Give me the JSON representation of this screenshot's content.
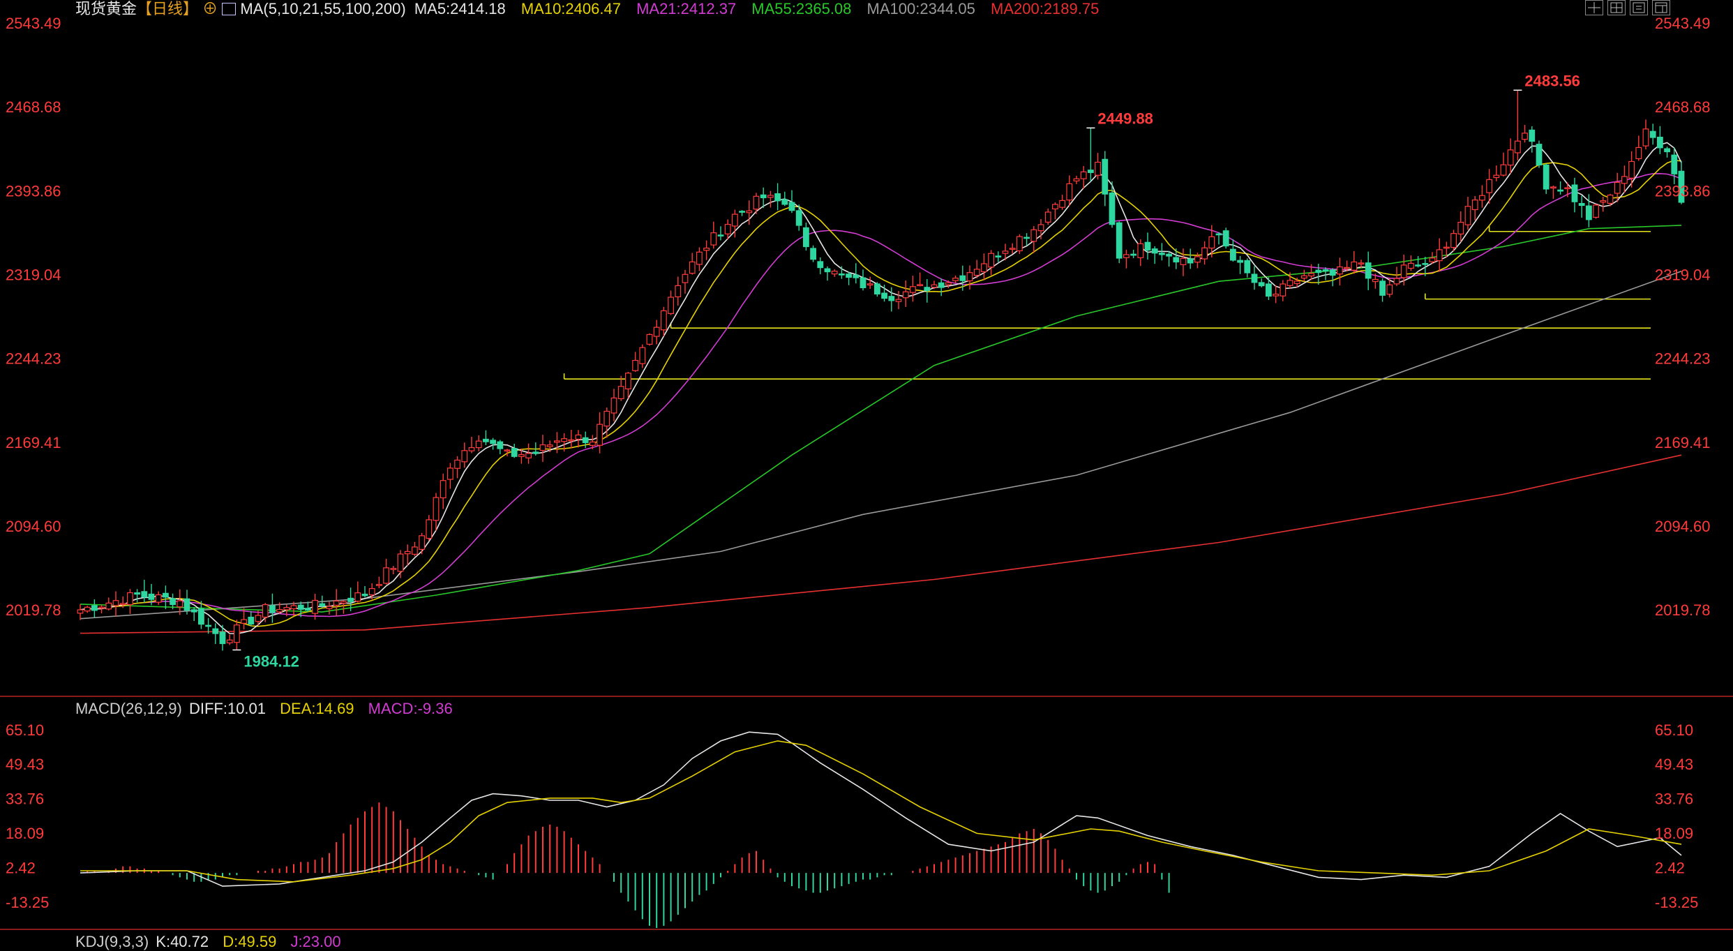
{
  "header": {
    "symbol": "现货黄金",
    "period": "【日线】",
    "ma_params": "MA(5,10,21,55,100,200)",
    "ma_values": [
      {
        "label": "MA5:2414.18",
        "color": "#e6e6e6"
      },
      {
        "label": "MA10:2406.47",
        "color": "#e6d200"
      },
      {
        "label": "MA21:2412.37",
        "color": "#d23cd2"
      },
      {
        "label": "MA55:2365.08",
        "color": "#28c828"
      },
      {
        "label": "MA100:2344.05",
        "color": "#9a9a9a"
      },
      {
        "label": "MA200:2189.75",
        "color": "#e83030"
      }
    ]
  },
  "colors": {
    "up": "#ff3b3b",
    "down": "#2ed6a0",
    "axis": "#ff3b3b",
    "grid_line": "#e6e61e"
  },
  "chart_data": [
    {
      "type": "candlestick",
      "title": "现货黄金【日线】",
      "ylim": [
        1944.6,
        2543.49
      ],
      "y_ticks": [
        2543.49,
        2468.68,
        2393.86,
        2319.04,
        2244.23,
        2169.41,
        2094.6,
        2019.78
      ],
      "y_tick_labels": [
        "2543.49",
        "2468.68",
        "2393.86",
        "2319.04",
        "2244.23",
        "2169.41",
        "2094.60",
        "2019.78"
      ],
      "annotations": [
        {
          "text": "2483.56",
          "value": 2483.56,
          "bar": 202,
          "type": "high"
        },
        {
          "text": "2449.88",
          "value": 2449.88,
          "bar": 142,
          "type": "high"
        },
        {
          "text": "1984.12",
          "value": 1984.12,
          "bar": 22,
          "type": "low"
        }
      ],
      "support_lines": [
        {
          "value": 2225.9,
          "from_bar": 68
        },
        {
          "value": 2271.3,
          "from_bar": 83
        },
        {
          "value": 2297.2,
          "from_bar": 189
        },
        {
          "value": 2357.5,
          "from_bar": 198
        }
      ],
      "keypoints": [
        {
          "bar": 0,
          "close": 2020
        },
        {
          "bar": 8,
          "close": 2033
        },
        {
          "bar": 14,
          "close": 2028
        },
        {
          "bar": 20,
          "close": 1993
        },
        {
          "bar": 26,
          "close": 2020
        },
        {
          "bar": 34,
          "close": 2024
        },
        {
          "bar": 40,
          "close": 2034
        },
        {
          "bar": 48,
          "close": 2085
        },
        {
          "bar": 52,
          "close": 2150
        },
        {
          "bar": 56,
          "close": 2175
        },
        {
          "bar": 60,
          "close": 2158
        },
        {
          "bar": 64,
          "close": 2160
        },
        {
          "bar": 68,
          "close": 2175
        },
        {
          "bar": 72,
          "close": 2172
        },
        {
          "bar": 76,
          "close": 2215
        },
        {
          "bar": 80,
          "close": 2265
        },
        {
          "bar": 84,
          "close": 2312
        },
        {
          "bar": 88,
          "close": 2345
        },
        {
          "bar": 92,
          "close": 2372
        },
        {
          "bar": 96,
          "close": 2388
        },
        {
          "bar": 100,
          "close": 2380
        },
        {
          "bar": 102,
          "close": 2340
        },
        {
          "bar": 106,
          "close": 2320
        },
        {
          "bar": 110,
          "close": 2310
        },
        {
          "bar": 114,
          "close": 2300
        },
        {
          "bar": 120,
          "close": 2310
        },
        {
          "bar": 124,
          "close": 2318
        },
        {
          "bar": 128,
          "close": 2335
        },
        {
          "bar": 134,
          "close": 2360
        },
        {
          "bar": 140,
          "close": 2405
        },
        {
          "bar": 143,
          "close": 2415
        },
        {
          "bar": 146,
          "close": 2336
        },
        {
          "bar": 150,
          "close": 2345
        },
        {
          "bar": 156,
          "close": 2330
        },
        {
          "bar": 160,
          "close": 2355
        },
        {
          "bar": 163,
          "close": 2326
        },
        {
          "bar": 167,
          "close": 2298
        },
        {
          "bar": 172,
          "close": 2318
        },
        {
          "bar": 176,
          "close": 2318
        },
        {
          "bar": 180,
          "close": 2330
        },
        {
          "bar": 183,
          "close": 2300
        },
        {
          "bar": 186,
          "close": 2325
        },
        {
          "bar": 190,
          "close": 2330
        },
        {
          "bar": 196,
          "close": 2384
        },
        {
          "bar": 200,
          "close": 2420
        },
        {
          "bar": 203,
          "close": 2450
        },
        {
          "bar": 206,
          "close": 2400
        },
        {
          "bar": 209,
          "close": 2395
        },
        {
          "bar": 212,
          "close": 2370
        },
        {
          "bar": 216,
          "close": 2398
        },
        {
          "bar": 220,
          "close": 2445
        },
        {
          "bar": 223,
          "close": 2432
        },
        {
          "bar": 225,
          "close": 2386
        }
      ],
      "ma_series": [
        {
          "name": "MA200",
          "color": "#e83030",
          "points": [
            [
              0,
              1999
            ],
            [
              40,
              2002
            ],
            [
              80,
              2022
            ],
            [
              120,
              2047
            ],
            [
              160,
              2080
            ],
            [
              200,
              2123
            ],
            [
              225,
              2158
            ]
          ]
        },
        {
          "name": "MA100",
          "color": "#9a9a9a",
          "points": [
            [
              0,
              2012
            ],
            [
              40,
              2030
            ],
            [
              70,
              2054
            ],
            [
              90,
              2072
            ],
            [
              110,
              2105
            ],
            [
              140,
              2140
            ],
            [
              170,
              2196
            ],
            [
              200,
              2265
            ],
            [
              225,
              2322
            ]
          ]
        },
        {
          "name": "MA55",
          "color": "#28c828",
          "points": [
            [
              0,
              2025
            ],
            [
              34,
              2018
            ],
            [
              50,
              2033
            ],
            [
              70,
              2055
            ],
            [
              80,
              2070
            ],
            [
              100,
              2158
            ],
            [
              120,
              2238
            ],
            [
              140,
              2282
            ],
            [
              160,
              2313
            ],
            [
              180,
              2325
            ],
            [
              200,
              2344
            ],
            [
              212,
              2360
            ],
            [
              225,
              2363
            ]
          ]
        }
      ]
    },
    {
      "type": "bar+line",
      "title": "MACD(26,12,9)",
      "legend": [
        {
          "label": "MACD(26,12,9)",
          "color": "#cfcfcf"
        },
        {
          "label": "DIFF:10.01",
          "color": "#e6e6e6"
        },
        {
          "label": "DEA:14.69",
          "color": "#e6d200"
        },
        {
          "label": "MACD:-9.36",
          "color": "#d23cd2"
        }
      ],
      "ylim": [
        -25,
        72
      ],
      "y_ticks": [
        65.1,
        49.43,
        33.76,
        18.09,
        2.42,
        -13.25
      ],
      "y_tick_labels": [
        "65.10",
        "49.43",
        "33.76",
        "18.09",
        "2.42",
        "-13.25"
      ],
      "series": [
        {
          "name": "DIFF",
          "color": "#e6e6e6",
          "points": [
            [
              0,
              0
            ],
            [
              8,
              1
            ],
            [
              15,
              1
            ],
            [
              20,
              -6
            ],
            [
              28,
              -5
            ],
            [
              36,
              -1
            ],
            [
              40,
              1
            ],
            [
              44,
              5
            ],
            [
              48,
              14
            ],
            [
              52,
              25
            ],
            [
              55,
              33
            ],
            [
              58,
              36
            ],
            [
              62,
              35
            ],
            [
              66,
              33
            ],
            [
              70,
              33
            ],
            [
              74,
              30
            ],
            [
              78,
              33
            ],
            [
              82,
              40
            ],
            [
              86,
              52
            ],
            [
              90,
              60
            ],
            [
              94,
              64
            ],
            [
              98,
              63
            ],
            [
              100,
              59
            ],
            [
              104,
              50
            ],
            [
              110,
              38
            ],
            [
              116,
              25
            ],
            [
              122,
              13
            ],
            [
              128,
              10
            ],
            [
              134,
              14
            ],
            [
              140,
              26
            ],
            [
              143,
              25
            ],
            [
              150,
              17
            ],
            [
              156,
              12
            ],
            [
              162,
              8
            ],
            [
              168,
              3
            ],
            [
              174,
              -2
            ],
            [
              180,
              -3
            ],
            [
              186,
              -1
            ],
            [
              192,
              -2
            ],
            [
              198,
              3
            ],
            [
              204,
              18
            ],
            [
              208,
              27
            ],
            [
              212,
              19
            ],
            [
              216,
              12
            ],
            [
              222,
              16
            ],
            [
              225,
              8
            ]
          ]
        },
        {
          "name": "DEA",
          "color": "#e6d200",
          "points": [
            [
              0,
              1
            ],
            [
              8,
              1
            ],
            [
              15,
              1
            ],
            [
              22,
              -3
            ],
            [
              30,
              -4
            ],
            [
              38,
              -1
            ],
            [
              44,
              2
            ],
            [
              48,
              6
            ],
            [
              52,
              14
            ],
            [
              56,
              26
            ],
            [
              60,
              32
            ],
            [
              66,
              34
            ],
            [
              72,
              34
            ],
            [
              76,
              32
            ],
            [
              80,
              34
            ],
            [
              86,
              44
            ],
            [
              92,
              55
            ],
            [
              98,
              60
            ],
            [
              102,
              58
            ],
            [
              110,
              45
            ],
            [
              118,
              30
            ],
            [
              126,
              18
            ],
            [
              134,
              15
            ],
            [
              142,
              20
            ],
            [
              146,
              19
            ],
            [
              152,
              14
            ],
            [
              158,
              10
            ],
            [
              166,
              5
            ],
            [
              174,
              1
            ],
            [
              182,
              0
            ],
            [
              190,
              -1
            ],
            [
              198,
              1
            ],
            [
              206,
              10
            ],
            [
              212,
              20
            ],
            [
              218,
              17
            ],
            [
              225,
              13
            ]
          ]
        }
      ],
      "bars": [
        0,
        1,
        1,
        0,
        1,
        2,
        3,
        3,
        2,
        2,
        1,
        1,
        0,
        -1,
        -2,
        -3,
        -4,
        -4,
        -3,
        -3,
        -2,
        -1,
        -1,
        0,
        0,
        1,
        1,
        2,
        2,
        3,
        4,
        5,
        5,
        6,
        7,
        9,
        14,
        18,
        22,
        25,
        28,
        30,
        32,
        30,
        28,
        24,
        20,
        16,
        12,
        8,
        6,
        4,
        3,
        2,
        1,
        0,
        -1,
        -2,
        -3,
        0,
        4,
        9,
        13,
        17,
        19,
        21,
        22,
        21,
        19,
        16,
        13,
        10,
        7,
        4,
        0,
        -4,
        -9,
        -13,
        -17,
        -21,
        -24,
        -25,
        -24,
        -22,
        -19,
        -16,
        -13,
        -10,
        -8,
        -5,
        -2,
        1,
        4,
        7,
        9,
        10,
        6,
        2,
        -2,
        -4,
        -6,
        -7,
        -8,
        -9,
        -9,
        -8,
        -7,
        -6,
        -5,
        -4,
        -3,
        -3,
        -2,
        -1,
        -1,
        0,
        0,
        1,
        2,
        3,
        4,
        5,
        6,
        7,
        8,
        9,
        10,
        11,
        12,
        13,
        14,
        16,
        18,
        19,
        20,
        18,
        15,
        11,
        6,
        2,
        -3,
        -6,
        -8,
        -9,
        -8,
        -6,
        -4,
        -1,
        2,
        4,
        5,
        4,
        -3,
        -9
      ]
    },
    {
      "type": "line",
      "title": "KDJ(9,3,3)",
      "legend": [
        {
          "label": "KDJ(9,3,3)",
          "color": "#cfcfcf"
        },
        {
          "label": "K:40.72",
          "color": "#e6e6e6"
        },
        {
          "label": "D:49.59",
          "color": "#e6d200"
        },
        {
          "label": "J:23.00",
          "color": "#d23cd2"
        }
      ]
    }
  ],
  "toolbar": [
    {
      "icon": "crosshair-icon"
    },
    {
      "icon": "grid-icon"
    },
    {
      "icon": "add-indicator-icon"
    },
    {
      "icon": "window-icon"
    }
  ]
}
